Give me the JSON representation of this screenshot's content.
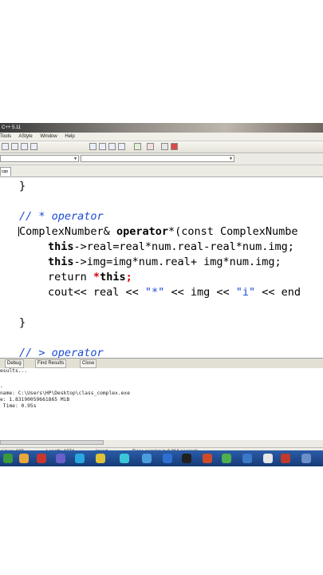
{
  "window": {
    "title": "C++ 5.11"
  },
  "menu": [
    "Tools",
    "AStyle",
    "Window",
    "Help"
  ],
  "tab": {
    "label": "cpp"
  },
  "code": {
    "l1": "}",
    "l2": "// * operator",
    "l3_type": "ComplexNumber&",
    "l3_kw": "operator",
    "l3_rest": "*(const ComplexNumbe",
    "l4_kw": "this",
    "l4_rest": "->real=real*num.real-real*num.img;",
    "l5_kw": "this",
    "l5_rest": "->img=img*num.real+ img*num.img;",
    "l6_kw": "return",
    "l6_star": "*",
    "l6_kw2": "this",
    "l6_end": ";",
    "l7_a": "cout<< real << ",
    "l7_s1": "\"*\"",
    "l7_b": " << img << ",
    "l7_s2": "\"i\"",
    "l7_c": " << end",
    "l8": "}",
    "l9": "// > operator"
  },
  "bottom_tabs": [
    "Debug",
    "Find Results",
    "Close"
  ],
  "output": {
    "line1": "esults...",
    "line2": "-",
    "line3": "name: C:\\Users\\HP\\Desktop\\class_complex.exe",
    "line4": "e: 1.83190059661865 MiB",
    "line5": " Time: 0.95s"
  },
  "status": {
    "lines": "Lines: 103",
    "length": "Length: 1374",
    "mode": "Insert",
    "parse": "Done parsing in 0.016 seconds"
  }
}
